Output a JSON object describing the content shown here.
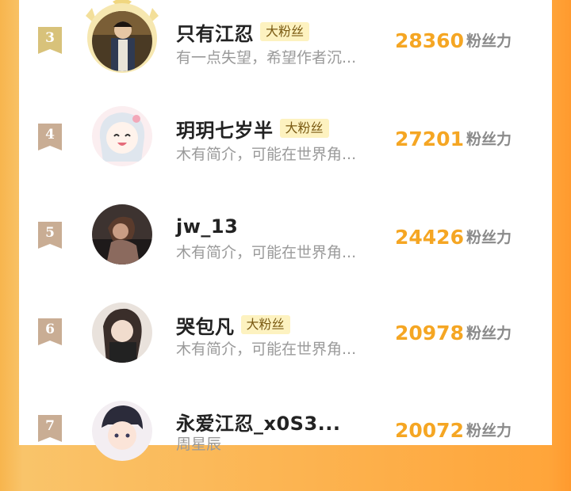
{
  "colors": {
    "accent": "#f5a623",
    "badge_bg": "#fdf2c0",
    "rank_gold": "#d8c27a",
    "rank_tan": "#c9ad94"
  },
  "ranking": {
    "unit_label": "粉丝力",
    "entries": [
      {
        "rank": "3",
        "name": "只有江忍",
        "badge": "大粉丝",
        "description": "有一点失望，希望作者沉...",
        "score": "28360",
        "avatar": "avatar-man-photo"
      },
      {
        "rank": "4",
        "name": "玥玥七岁半",
        "badge": "大粉丝",
        "description": "木有简介，可能在世界角...",
        "score": "27201",
        "avatar": "avatar-anime-girl"
      },
      {
        "rank": "5",
        "name": "jw_13",
        "badge": "",
        "description": "木有简介，可能在世界角...",
        "score": "24426",
        "avatar": "avatar-girl-photo"
      },
      {
        "rank": "6",
        "name": "哭包凡",
        "badge": "大粉丝",
        "description": "木有简介，可能在世界角...",
        "score": "20978",
        "avatar": "avatar-girl-photo"
      },
      {
        "rank": "7",
        "name": "永爱江忍_x0S3...",
        "badge": "",
        "description": "周星辰",
        "score": "20072",
        "avatar": "avatar-anime-boy"
      }
    ]
  }
}
